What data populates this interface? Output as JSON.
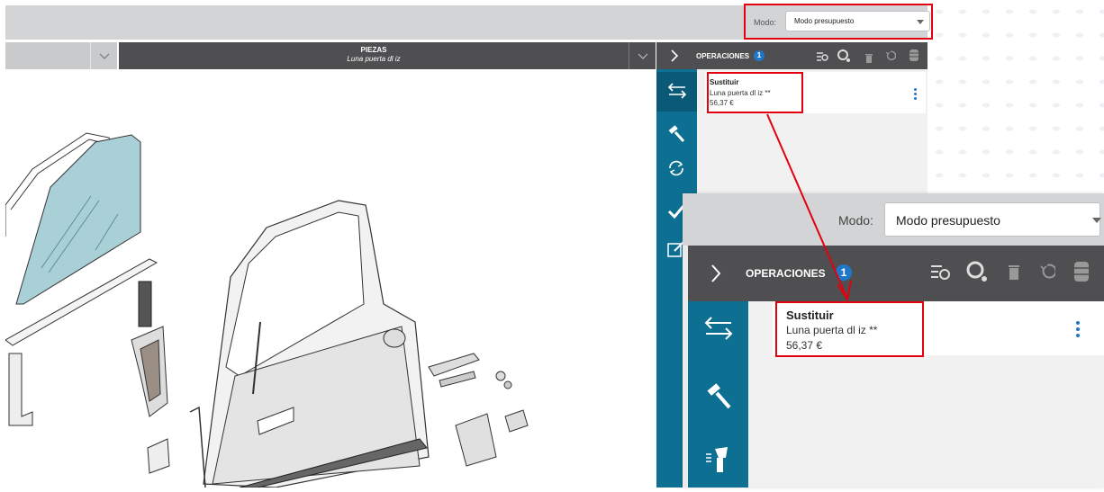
{
  "mode_bar": {
    "label": "Modo:",
    "value": "Modo presupuesto"
  },
  "piezas": {
    "title": "PIEZAS",
    "subtitle": "Luna puerta dl iz"
  },
  "operaciones": {
    "label": "OPERACIONES",
    "count": "1"
  },
  "operation": {
    "action": "Sustituir",
    "part": "Luna puerta dl iz **",
    "price": "56,37 €"
  },
  "zoom": {
    "mode_label": "Modo:",
    "mode_value": "Modo presupuesto",
    "ops_label": "OPERACIONES",
    "ops_count": "1",
    "op_action": "Sustituir",
    "op_part": "Luna puerta dl iz **",
    "op_price": "56,37 €"
  },
  "colors": {
    "sidebar": "#0d6f92",
    "header": "#4f4f51",
    "badge": "#1f77c9",
    "highlight": "#e3000f",
    "glass": "#a9d0d6"
  },
  "icons": {
    "sidebar": [
      "swap-arrows-icon",
      "hammer-icon",
      "refresh-icon",
      "check-icon",
      "edit-icon"
    ],
    "toolbar": [
      "search-list-icon",
      "search-settings-icon",
      "trash-icon",
      "undo-icon",
      "database-icon"
    ],
    "zoom_sidebar": [
      "swap-arrows-icon",
      "hammer-icon",
      "spray-gun-icon"
    ]
  }
}
